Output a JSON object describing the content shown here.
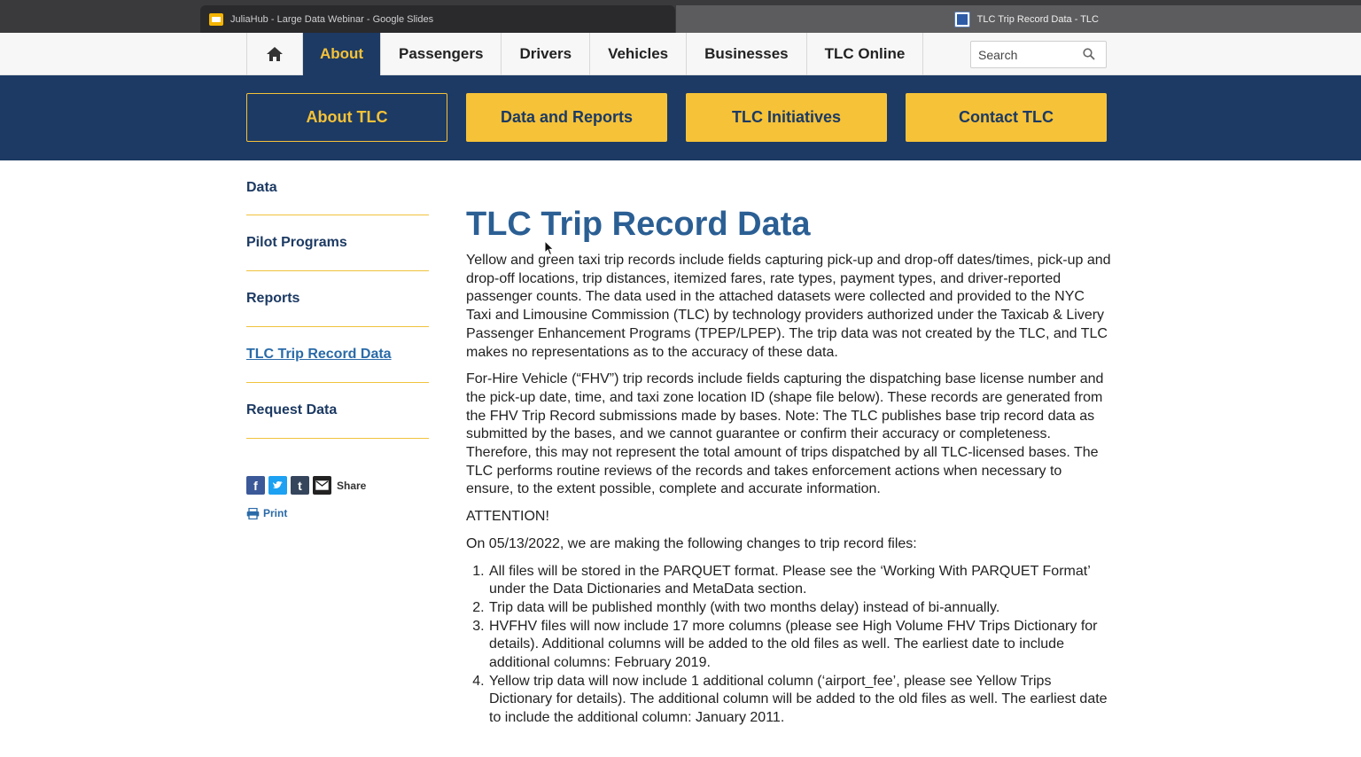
{
  "browser": {
    "tabs": [
      {
        "title": "JuliaHub - Large Data Webinar - Google Slides",
        "icon": "slides-icon"
      },
      {
        "title": "TLC Trip Record Data - TLC",
        "icon": "tlc-favicon-icon"
      }
    ]
  },
  "topnav": {
    "items": [
      "About",
      "Passengers",
      "Drivers",
      "Vehicles",
      "Businesses",
      "TLC Online"
    ],
    "active": "About",
    "search_placeholder": "Search"
  },
  "band": {
    "buttons": [
      "About TLC",
      "Data and Reports",
      "TLC Initiatives",
      "Contact TLC"
    ]
  },
  "sidebar": {
    "items": [
      "Data",
      "Pilot Programs",
      "Reports",
      "TLC Trip Record Data",
      "Request Data"
    ],
    "current": "TLC Trip Record Data",
    "share_label": "Share",
    "print_label": "Print"
  },
  "main": {
    "title": "TLC Trip Record Data",
    "p1": "Yellow and green taxi trip records include fields capturing pick-up and drop-off dates/times, pick-up and drop-off locations, trip distances, itemized fares, rate types, payment types, and driver-reported passenger counts. The data used in the attached datasets were collected and provided to the NYC Taxi and Limousine Commission (TLC) by technology providers authorized under the Taxicab & Livery Passenger Enhancement Programs (TPEP/LPEP). The trip data was not created by the TLC, and TLC makes no representations as to the accuracy of these data.",
    "p2": "For-Hire Vehicle (“FHV”) trip records include fields capturing the dispatching base license number and the pick-up date, time, and taxi zone location ID (shape file below). These records are generated from the FHV Trip Record submissions made by bases. Note: The TLC publishes base trip record data as submitted by the bases, and we cannot guarantee or confirm their accuracy or completeness. Therefore, this may not represent the total amount of trips dispatched by all TLC-licensed bases. The TLC performs routine reviews of the records and takes enforcement actions when necessary to ensure, to the extent possible, complete and accurate information.",
    "attention": "ATTENTION!",
    "intro": "On 05/13/2022, we are making the following changes to trip record files:",
    "changes": [
      "All files will be stored in the PARQUET format. Please see the ‘Working With PARQUET Format’ under the Data Dictionaries and MetaData section.",
      "Trip data will be published monthly (with two months delay) instead of bi-annually.",
      "HVFHV files will now include 17 more columns (please see High Volume FHV Trips Dictionary for details). Additional columns will be added to the old files as well. The earliest date to include additional columns: February 2019.",
      "Yellow trip data will now include 1 additional column (‘airport_fee’, please see Yellow Trips Dictionary for details). The additional column will be added to the old files as well. The earliest date to include the additional column: January 2011."
    ]
  },
  "colors": {
    "navy": "#1c3a63",
    "gold": "#f6c238",
    "link_blue": "#2a6aa8",
    "title_blue": "#2b5f94"
  }
}
